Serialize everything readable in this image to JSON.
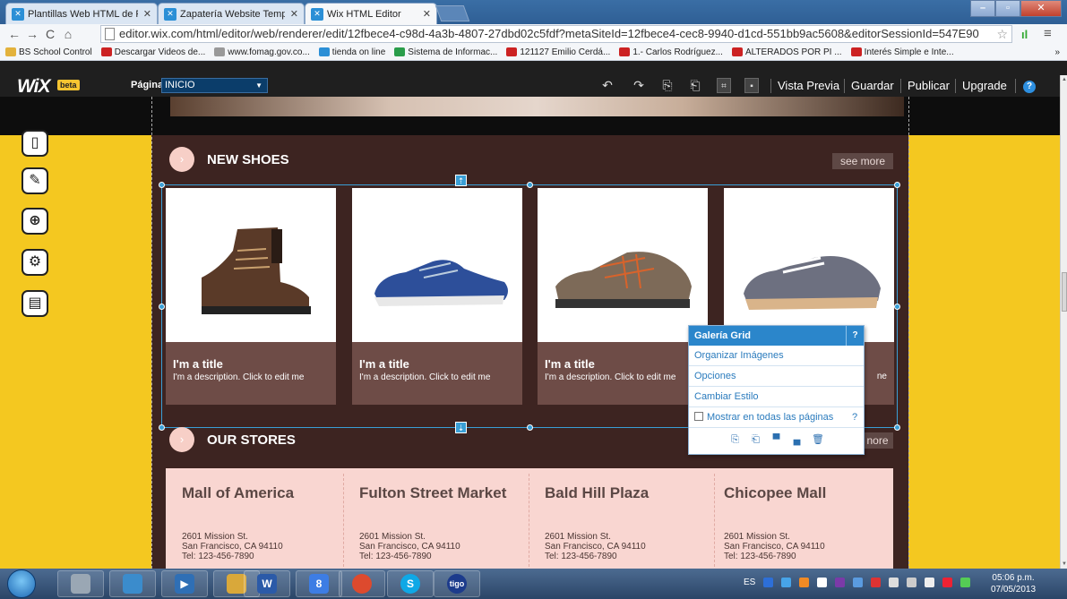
{
  "browser": {
    "tabs": [
      {
        "label": "Plantillas Web HTML de R",
        "active": false
      },
      {
        "label": "Zapatería Website Templa",
        "active": false
      },
      {
        "label": "Wix HTML Editor",
        "active": true
      }
    ],
    "url": "editor.wix.com/html/editor/web/renderer/edit/12fbece4-c98d-4a3b-4807-27dbd02c5fdf?metaSiteId=12fbece4-cec8-9940-d1cd-551bb9ac5608&editorSessionId=547E90",
    "bookmarks": [
      {
        "label": "BS School Control",
        "color": "#e3b23c"
      },
      {
        "label": "Descargar Videos de...",
        "color": "#cc2222"
      },
      {
        "label": "www.fomag.gov.co...",
        "color": "#999999"
      },
      {
        "label": "tienda on line",
        "color": "#2b8fd6"
      },
      {
        "label": "Sistema de Informac...",
        "color": "#2a9d4a"
      },
      {
        "label": "121127 Emilio Cerdá...",
        "color": "#cc2222"
      },
      {
        "label": "1.- Carlos Rodríguez...",
        "color": "#cc2222"
      },
      {
        "label": "ALTERADOS POR PI ...",
        "color": "#cc2222"
      },
      {
        "label": "Interés Simple e Inte...",
        "color": "#cc2222"
      }
    ],
    "bookmarks_overflow": "»"
  },
  "editor": {
    "logo": "WiX",
    "beta": "beta",
    "page_label": "Página",
    "page_value": "INICIO",
    "links": {
      "preview": "Vista Previa",
      "save": "Guardar",
      "publish": "Publicar",
      "upgrade": "Upgrade"
    },
    "help": "?"
  },
  "site": {
    "new_shoes_title": "NEW SHOES",
    "see_more": "see more",
    "see_more_partial": "nore",
    "products": [
      {
        "title": "I'm a title",
        "description": "I'm a description. Click to edit me"
      },
      {
        "title": "I'm a title",
        "description": "I'm a description. Click to edit me"
      },
      {
        "title": "I'm a title",
        "description": "I'm a description. Click to edit me"
      },
      {
        "title": "",
        "description": "ne"
      }
    ],
    "stores_title": "OUR STORES",
    "stores": [
      {
        "name": "Mall of America",
        "addr1": "2601 Mission St.",
        "addr2": "San Francisco, CA 94110",
        "tel": "Tel: 123-456-7890"
      },
      {
        "name": "Fulton Street Market",
        "addr1": "2601 Mission St.",
        "addr2": "San Francisco, CA 94110",
        "tel": "Tel: 123-456-7890"
      },
      {
        "name": "Bald Hill Plaza",
        "addr1": "2601 Mission St.",
        "addr2": "San Francisco, CA 94110",
        "tel": "Tel: 123-456-7890"
      },
      {
        "name": "Chicopee Mall",
        "addr1": "2601 Mission St.",
        "addr2": "San Francisco, CA 94110",
        "tel": "Tel: 123-456-7890"
      }
    ]
  },
  "context_menu": {
    "header": "Galería Grid",
    "header_help": "?",
    "items": [
      "Organizar Imágenes",
      "Opciones",
      "Cambiar Estilo"
    ],
    "checkbox_label": "Mostrar en todas las páginas",
    "checkbox_help": "?"
  },
  "taskbar": {
    "lang": "ES",
    "time": "05:06 p.m.",
    "date": "07/05/2013"
  }
}
